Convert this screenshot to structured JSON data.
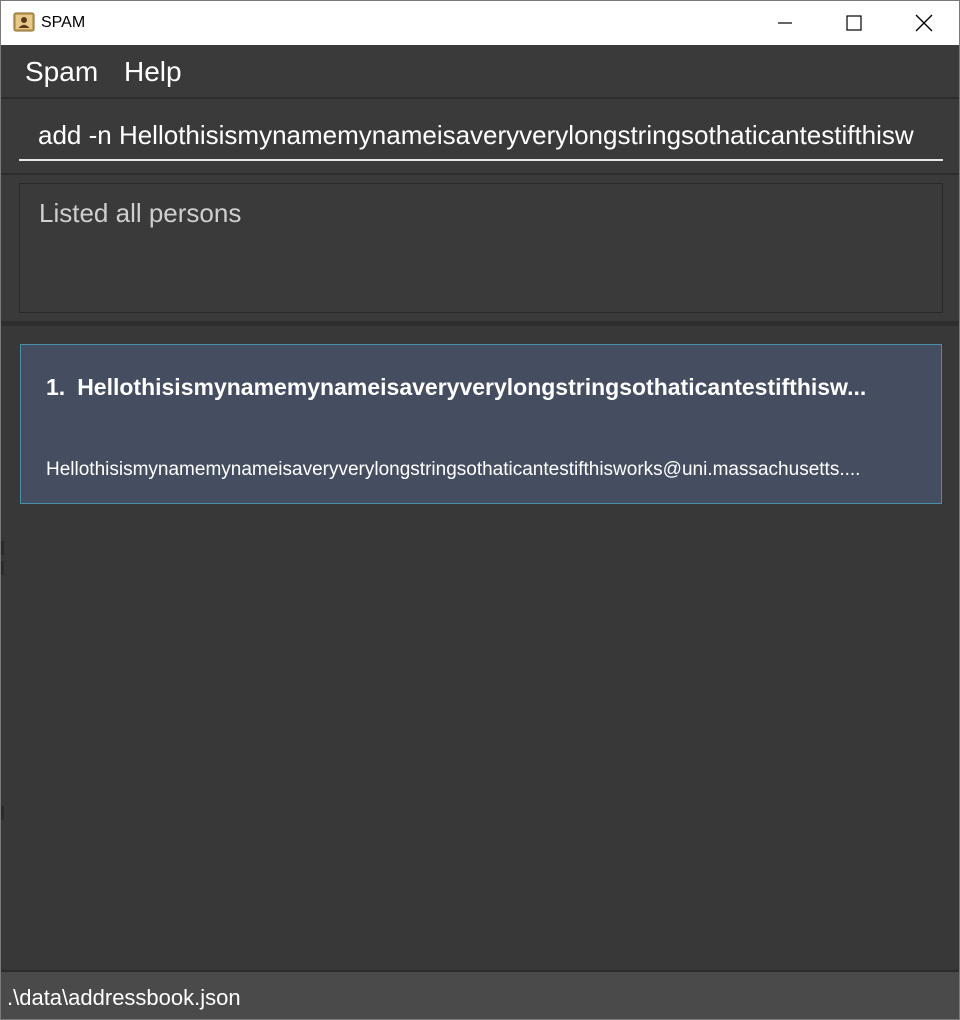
{
  "window": {
    "title": "SPAM",
    "app_icon": "contact-book-icon",
    "controls": {
      "minimize": "minimize-icon",
      "maximize": "maximize-icon",
      "close": "close-icon"
    }
  },
  "menubar": {
    "items": [
      {
        "label": "Spam"
      },
      {
        "label": "Help"
      }
    ]
  },
  "command": {
    "value": "add -n Hellothisismynamemynameisaveryverylongstringsothaticantestifthisw"
  },
  "result": {
    "message": "Listed all persons"
  },
  "person_list": [
    {
      "index": "1.",
      "name": "Hellothisismynamemynameisaveryverylongstringsothaticantestifthisw...",
      "email": "Hellothisismynamemynameisaveryverylongstringsothaticantestifthisworks@uni.massachusetts...."
    }
  ],
  "status": {
    "file_path": ".\\data\\addressbook.json"
  },
  "colors": {
    "background": "#3a3a3a",
    "card_background": "#444e60",
    "card_border": "#4a8fa8",
    "statusbar": "#4a4a4a"
  }
}
